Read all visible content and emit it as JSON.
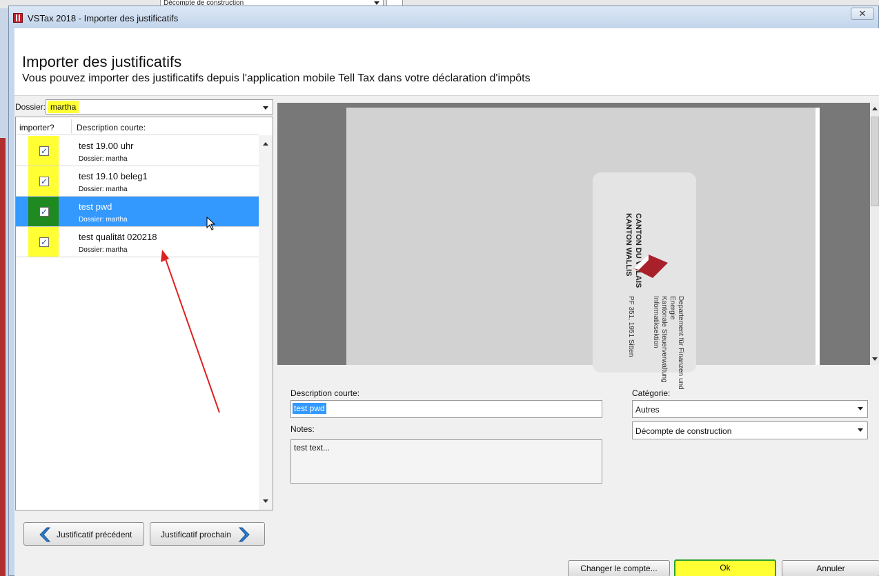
{
  "background": {
    "combo_text": "Décompte de construction"
  },
  "window": {
    "title": "VSTax 2018 - Importer des justificatifs",
    "close_glyph": "✕"
  },
  "header": {
    "title": "Importer des justificatifs",
    "subtitle": "Vous pouvez importer des justificatifs depuis l'application mobile Tell Tax dans votre déclaration d'impôts"
  },
  "dossier": {
    "label": "Dossier:",
    "value": "martha"
  },
  "list": {
    "columns": [
      "importer?",
      "Description courte:"
    ],
    "items": [
      {
        "title": "test 19.00 uhr",
        "subtitle": "Dossier: martha",
        "checked": true,
        "selected": false
      },
      {
        "title": "test 19.10 beleg1",
        "subtitle": "Dossier: martha",
        "checked": true,
        "selected": false
      },
      {
        "title": "test pwd",
        "subtitle": "Dossier: martha",
        "checked": true,
        "selected": true
      },
      {
        "title": "test qualität 020218",
        "subtitle": "Dossier: martha",
        "checked": true,
        "selected": false
      }
    ],
    "check_glyph": "✓"
  },
  "nav": {
    "prev_label": "Justificatif précédent",
    "next_label": "Justificatif prochain"
  },
  "preview": {
    "card_line1": "CANTON DU VALAIS",
    "card_line2": "KANTON WALLIS",
    "card_dept1": "Departement für Finanzen und",
    "card_dept2": "Energie",
    "card_dept3": "Kantonale Steuerverwaltung",
    "card_dept4": "Informatiksektion",
    "card_address": "PF 351, 1951 Sitten"
  },
  "form": {
    "desc_label": "Description courte:",
    "desc_value": "test pwd",
    "notes_label": "Notes:",
    "notes_value": "test text...",
    "category_label": "Catégorie:",
    "category_value": "Autres",
    "subcategory_value": "Décompte de construction"
  },
  "buttons": {
    "change_account": "Changer le compte...",
    "ok": "Ok",
    "cancel": "Annuler"
  },
  "colors": {
    "highlight": "#ffff33",
    "selection": "#3399ff",
    "annotation_arrow": "#e02020"
  }
}
